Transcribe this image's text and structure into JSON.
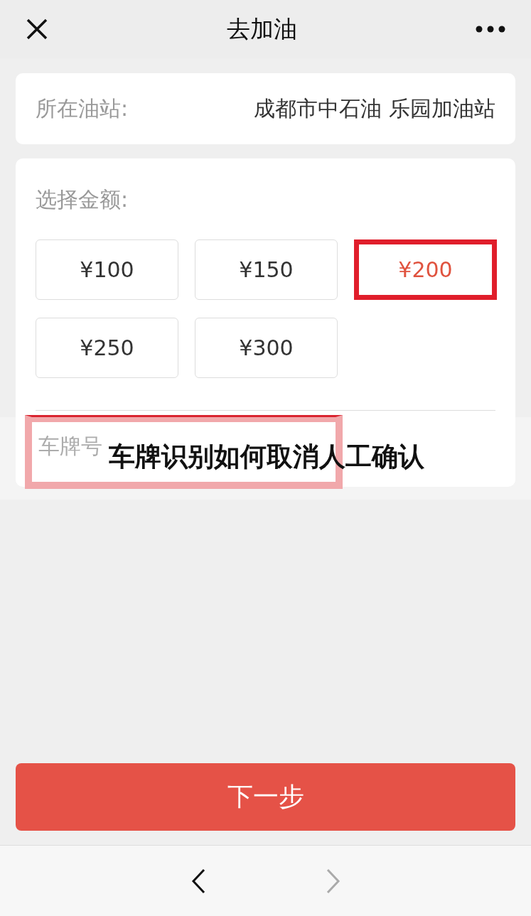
{
  "nav": {
    "title": "去加油"
  },
  "station": {
    "label": "所在油站:",
    "value": "成都市中石油 乐园加油站"
  },
  "amount": {
    "label": "选择金额:",
    "options": [
      {
        "label": "¥100",
        "selected": false
      },
      {
        "label": "¥150",
        "selected": false
      },
      {
        "label": "¥200",
        "selected": true
      },
      {
        "label": "¥250",
        "selected": false
      },
      {
        "label": "¥300",
        "selected": false
      }
    ]
  },
  "plate": {
    "label": "车牌号"
  },
  "next_button": "下一步",
  "overlay": {
    "caption": "车牌识别如何取消人工确认"
  },
  "toolbar": {
    "back_disabled": false,
    "forward_disabled": true
  }
}
